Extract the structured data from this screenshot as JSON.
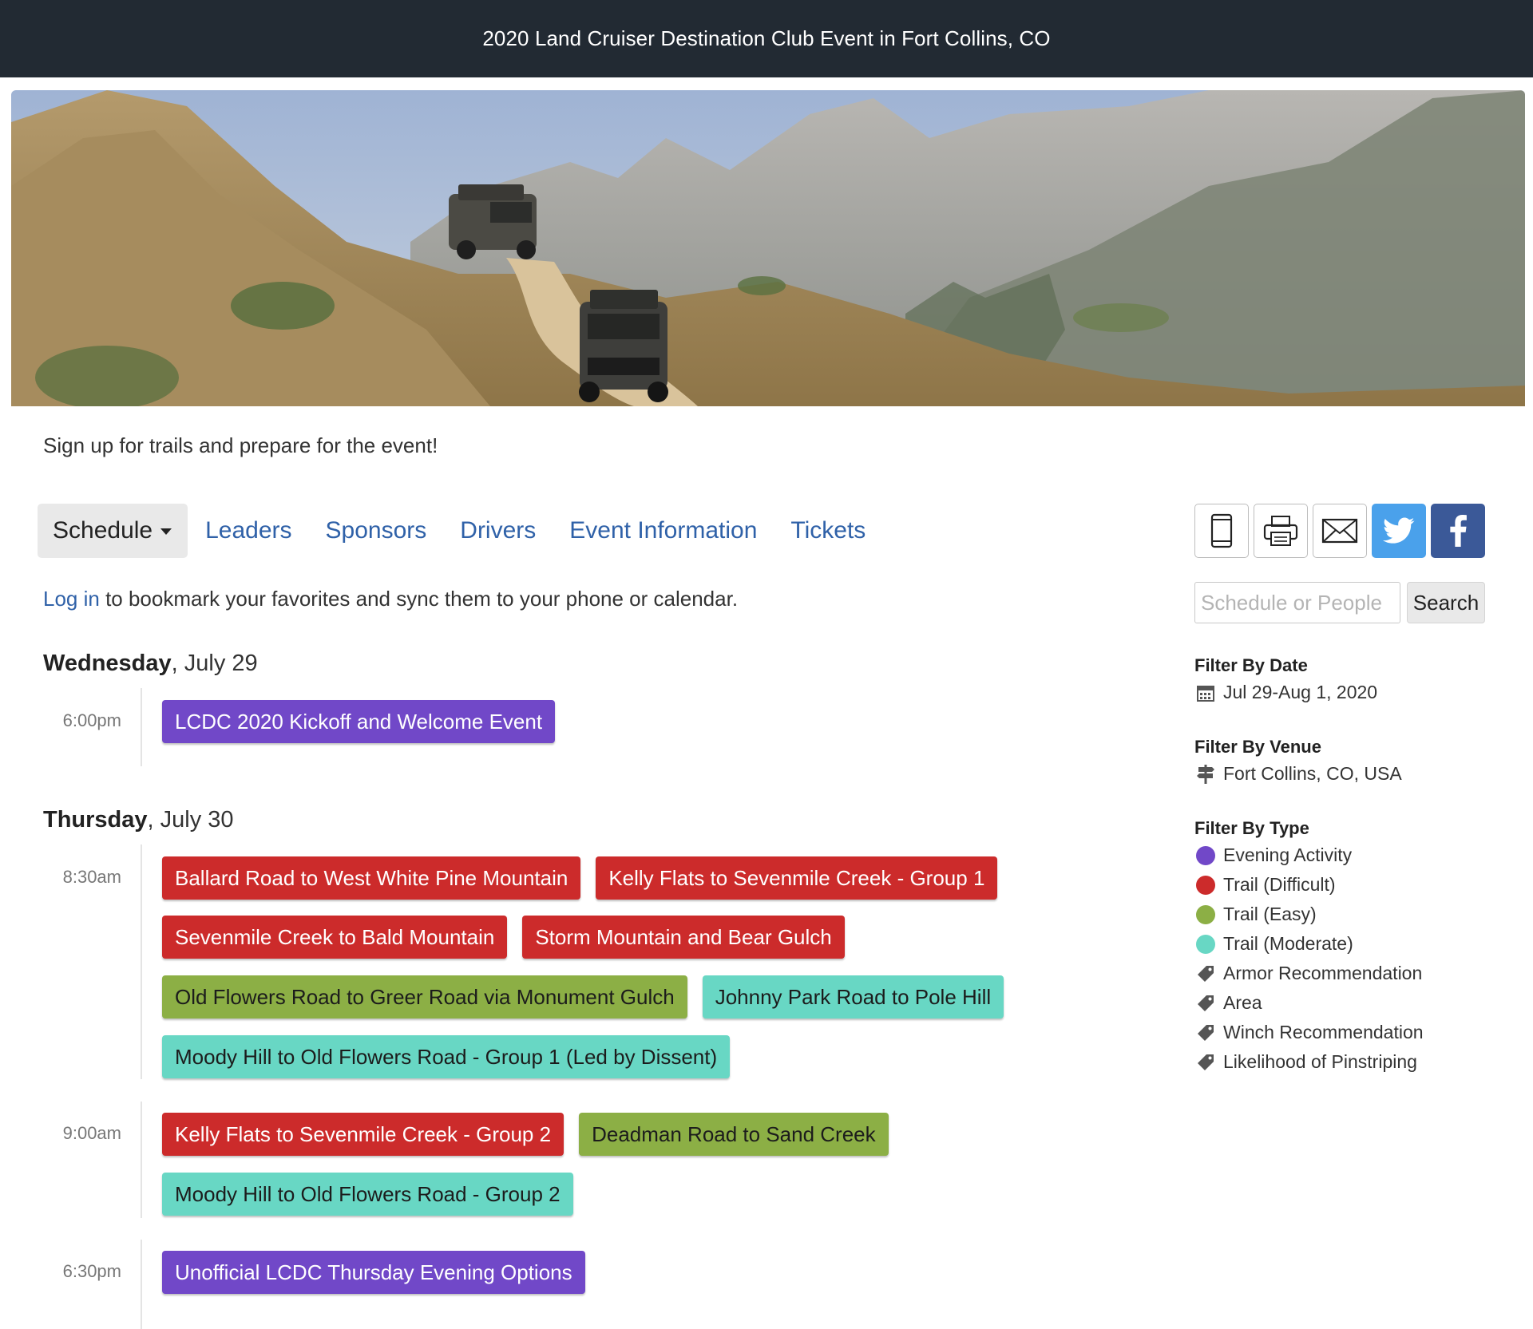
{
  "header": {
    "title": "2020 Land Cruiser Destination Club Event in Fort Collins, CO"
  },
  "banner": {
    "icon": "photo-banner"
  },
  "tagline": "Sign up for trails and prepare for the event!",
  "nav": {
    "schedule_label": "Schedule",
    "links": [
      "Leaders",
      "Sponsors",
      "Drivers",
      "Event Information",
      "Tickets"
    ]
  },
  "login": {
    "link": "Log in",
    "text": " to bookmark your favorites and sync them to your phone or calendar."
  },
  "days": [
    {
      "day": "Wednesday",
      "date": ", July 29"
    },
    {
      "day": "Thursday",
      "date": ", July 30"
    }
  ],
  "slots": [
    {
      "time": "6:00pm",
      "rows": [
        [
          {
            "label": "LCDC 2020 Kickoff and Welcome Event",
            "type": "evening"
          }
        ]
      ]
    },
    {
      "time": "8:30am",
      "rows": [
        [
          {
            "label": "Ballard Road to West White Pine Mountain",
            "type": "difficult"
          },
          {
            "label": "Kelly Flats to Sevenmile Creek - Group 1",
            "type": "difficult"
          }
        ],
        [
          {
            "label": "Sevenmile Creek to Bald Mountain",
            "type": "difficult"
          },
          {
            "label": "Storm Mountain and Bear Gulch",
            "type": "difficult"
          }
        ],
        [
          {
            "label": "Old Flowers Road to Greer Road via Monument Gulch",
            "type": "easy"
          },
          {
            "label": "Johnny Park Road to Pole Hill",
            "type": "moderate"
          }
        ],
        [
          {
            "label": "Moody Hill to Old Flowers Road - Group 1 (Led by Dissent)",
            "type": "moderate"
          }
        ]
      ]
    },
    {
      "time": "9:00am",
      "rows": [
        [
          {
            "label": "Kelly Flats to Sevenmile Creek - Group 2",
            "type": "difficult"
          },
          {
            "label": "Deadman Road to Sand Creek",
            "type": "easy"
          }
        ],
        [
          {
            "label": "Moody Hill to Old Flowers Road - Group 2",
            "type": "moderate"
          }
        ]
      ]
    },
    {
      "time": "6:30pm",
      "rows": [
        [
          {
            "label": "Unofficial LCDC Thursday Evening Options",
            "type": "evening"
          }
        ]
      ]
    }
  ],
  "share": {
    "icons": [
      "phone-icon",
      "print-icon",
      "email-icon",
      "twitter-icon",
      "facebook-icon"
    ],
    "twitter_color": "#4aa1eb",
    "facebook_color": "#3b5998"
  },
  "search": {
    "placeholder": "Schedule or People",
    "button": "Search"
  },
  "filters": {
    "date": {
      "heading": "Filter By Date",
      "value": "Jul 29-Aug 1, 2020",
      "icon": "calendar-icon"
    },
    "venue": {
      "heading": "Filter By Venue",
      "value": "Fort Collins, CO, USA",
      "icon": "signpost-icon"
    },
    "type": {
      "heading": "Filter By Type",
      "colored": [
        {
          "label": "Evening Activity",
          "color": "#7148c8"
        },
        {
          "label": "Trail (Difficult)",
          "color": "#cc2b2b"
        },
        {
          "label": "Trail (Easy)",
          "color": "#8caf45"
        },
        {
          "label": "Trail (Moderate)",
          "color": "#68d7c4"
        }
      ],
      "tags": [
        "Armor Recommendation",
        "Area",
        "Winch Recommendation",
        "Likelihood of Pinstriping"
      ],
      "tag_icon": "tag-icon"
    }
  },
  "colors": {
    "header_bg": "#222a33",
    "link": "#2f61a8",
    "evening": "#7148c8",
    "difficult": "#cc2b2b",
    "easy": "#8caf45",
    "moderate": "#68d7c4"
  }
}
